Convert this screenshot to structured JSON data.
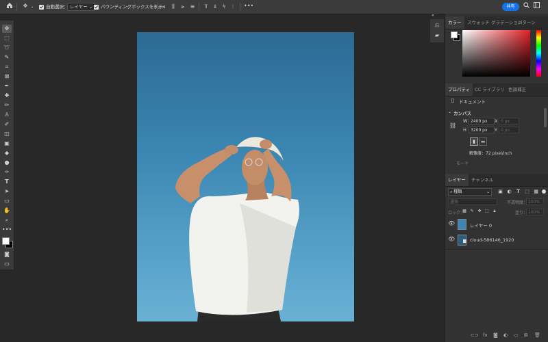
{
  "options_bar": {
    "auto_select_label": "自動選択：",
    "layer_select": "レイヤー",
    "bounding_box_label": "バウンディングボックスを表示",
    "more": "•••",
    "share_label": "共有"
  },
  "color_panel": {
    "tabs": [
      "カラー",
      "スウォッチ",
      "グラデーション",
      "パターン"
    ]
  },
  "properties_panel": {
    "tabs": [
      "プロパティ",
      "CC ライブラリ",
      "色調補正"
    ],
    "doc_label": "ドキュメント",
    "canvas_label": "カンバス",
    "w_label": "W",
    "h_label": "H",
    "x_label": "X",
    "y_label": "Y",
    "width": "2400 px",
    "height": "3200 px",
    "x_placeholder": "0 px",
    "y_placeholder": "0 px",
    "resolution": "解像度：72 pixel/inch",
    "mode_label": "モード"
  },
  "layers_panel": {
    "tabs": [
      "レイヤー",
      "チャンネル"
    ],
    "filter_kind": "種類",
    "blend_mode": "通常",
    "opacity_label": "不透明度：",
    "opacity": "100%",
    "lock_label": "ロック：",
    "fill_label": "塗り：",
    "fill": "100%",
    "layers": [
      {
        "name": "レイヤー 0"
      },
      {
        "name": "cloud-586146_1920"
      }
    ]
  },
  "colors": {
    "accent": "#1473e6",
    "panel_bg": "#323232",
    "app_bg": "#282828",
    "foreground": "#ffffff",
    "background_swatch": "#000000"
  }
}
